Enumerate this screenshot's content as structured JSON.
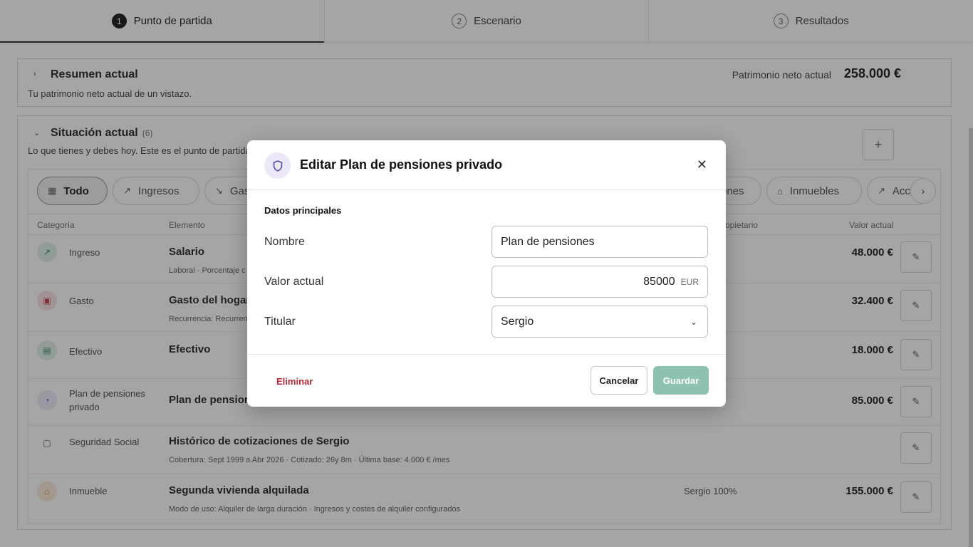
{
  "stepper": {
    "steps": [
      {
        "num": "1",
        "label": "Punto de partida"
      },
      {
        "num": "2",
        "label": "Escenario"
      },
      {
        "num": "3",
        "label": "Resultados"
      }
    ]
  },
  "resumen": {
    "title": "Resumen actual",
    "subtitle": "Tu patrimonio neto actual de un vistazo.",
    "net_label": "Patrimonio neto actual",
    "net_value": "258.000 €"
  },
  "situacion": {
    "title": "Situación actual",
    "count": "(6)",
    "subtitle": "Lo que tienes y debes hoy. Este es el punto de partida",
    "add_label": "+",
    "filters": [
      "Todo",
      "Ingresos",
      "Gas",
      "ones",
      "Inmuebles",
      "Acc"
    ],
    "next_label": "›",
    "columns": {
      "category": "Categoría",
      "element": "Elemento",
      "owner": "opietario",
      "value": "Valor actual"
    },
    "rows": [
      {
        "category": "Ingreso",
        "title": "Salario",
        "meta": "Laboral · Porcentaje c",
        "owner": "",
        "value": "48.000 €"
      },
      {
        "category": "Gasto",
        "title": "Gasto del hogar",
        "meta": "Recurrencia: Recurrente",
        "owner": "",
        "value": "32.400 €"
      },
      {
        "category": "Efectivo",
        "title": "Efectivo",
        "meta": "",
        "owner": "",
        "value": "18.000 €"
      },
      {
        "category": "Plan de pensiones privado",
        "title": "Plan de pensione",
        "meta": "",
        "owner": "",
        "value": "85.000 €"
      },
      {
        "category": "Seguridad Social",
        "title": "Histórico de cotizaciones de Sergio",
        "meta": "Cobertura: Sept 1999 a Abr 2026 · Cotizado: 26y 8m · Última base: 4.000 € /mes",
        "owner": "",
        "value": ""
      },
      {
        "category": "Inmueble",
        "title": "Segunda vivienda alquilada",
        "meta": "Modo de uso: Alquiler de larga duración · Ingresos y costes de alquiler configurados",
        "owner": "Sergio 100%",
        "value": "155.000 €"
      }
    ]
  },
  "modal": {
    "title": "Editar Plan de pensiones privado",
    "section": "Datos principales",
    "fields": {
      "nombre_label": "Nombre",
      "nombre_value": "Plan de pensiones",
      "valor_label": "Valor actual",
      "valor_value": "85000",
      "valor_unit": "EUR",
      "titular_label": "Titular",
      "titular_value": "Sergio"
    },
    "delete_label": "Eliminar",
    "cancel_label": "Cancelar",
    "save_label": "Guardar"
  },
  "colors": {
    "accent_save": "#8fc1b1",
    "delete": "#b5273a",
    "pension_icon_bg": "#ece8f7",
    "income_icon_bg": "#dff0e6",
    "expense_icon_bg": "#f9e0e0",
    "home_icon_bg": "#fbe9d6"
  },
  "icons": {
    "modal": "shield-icon",
    "close": "close-icon",
    "select": "chevron-down-icon"
  }
}
